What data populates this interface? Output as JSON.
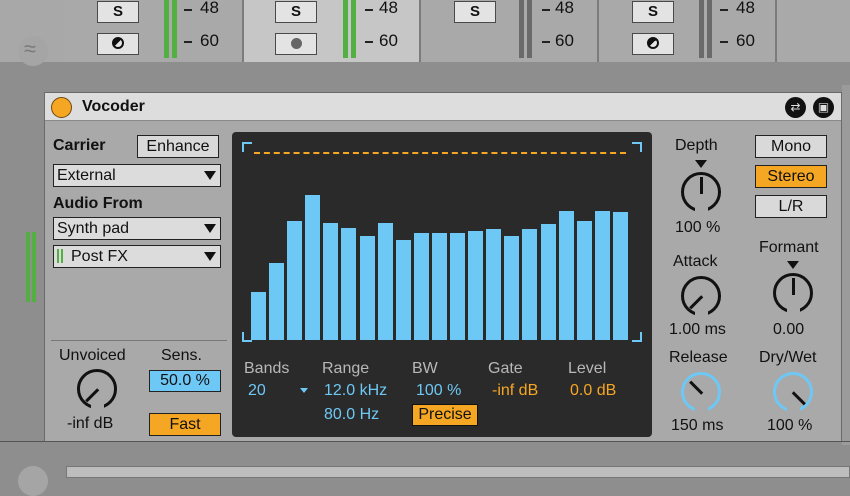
{
  "mixer": {
    "tracks": [
      {
        "solo": "S",
        "tick_48": "48",
        "tick_60": "60"
      },
      {
        "solo": "S",
        "tick_48": "48",
        "tick_60": "60"
      },
      {
        "solo": "S",
        "tick_48": "48",
        "tick_60": "60"
      },
      {
        "solo": "S",
        "tick_48": "48",
        "tick_60": "60"
      }
    ]
  },
  "device": {
    "title": "Vocoder",
    "carrier_label": "Carrier",
    "enhance_label": "Enhance",
    "carrier_value": "External",
    "audio_from_label": "Audio From",
    "audio_from_value": "Synth pad",
    "audio_from_tap": "Post FX",
    "unvoiced_label": "Unvoiced",
    "unvoiced_value": "-inf dB",
    "sens_label": "Sens.",
    "sens_value": "50.0 %",
    "fast_label": "Fast",
    "display": {
      "bands_label": "Bands",
      "bands_value": "20",
      "range_label": "Range",
      "range_high": "12.0 kHz",
      "range_low": "80.0 Hz",
      "bw_label": "BW",
      "bw_value": "100 %",
      "precise_label": "Precise",
      "gate_label": "Gate",
      "gate_value": "-inf dB",
      "level_label": "Level",
      "level_value": "0.0 dB",
      "band_levels": [
        0.28,
        0.45,
        0.7,
        0.85,
        0.69,
        0.66,
        0.61,
        0.69,
        0.59,
        0.63,
        0.63,
        0.63,
        0.64,
        0.65,
        0.61,
        0.65,
        0.68,
        0.76,
        0.7,
        0.76,
        0.75
      ]
    },
    "depth_label": "Depth",
    "depth_value": "100 %",
    "attack_label": "Attack",
    "attack_value": "1.00 ms",
    "release_label": "Release",
    "release_value": "150 ms",
    "mono_label": "Mono",
    "stereo_label": "Stereo",
    "lr_label": "L/R",
    "formant_label": "Formant",
    "formant_value": "0.00",
    "drywet_label": "Dry/Wet",
    "drywet_value": "100 %",
    "accent_color": "#f5a623",
    "value_color": "#6ec8f5"
  }
}
